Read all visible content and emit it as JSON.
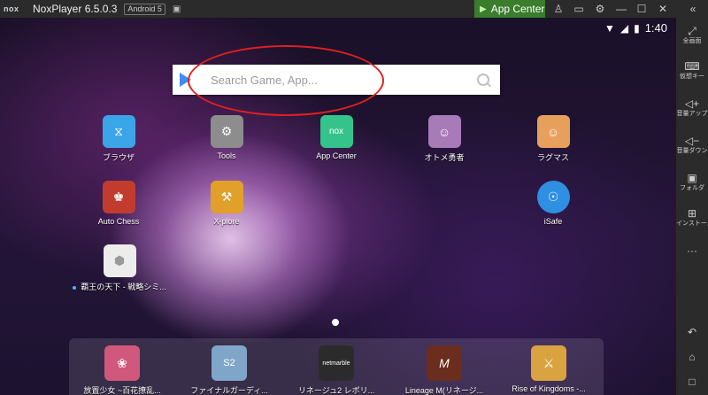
{
  "titlebar": {
    "logo": "nox",
    "app_name": "NoxPlayer 6.5.0.3",
    "android_badge": "Android 5",
    "app_center_label": "App Center",
    "buttons": [
      "shirt-icon",
      "minimize-window-icon",
      "settings-icon",
      "minimize-icon",
      "maximize-icon",
      "close-icon",
      "collapse-sidebar-icon"
    ]
  },
  "status": {
    "time": "1:40"
  },
  "search": {
    "placeholder": "Search Game, App..."
  },
  "apps": [
    {
      "label": "ブラウザ",
      "color": "#3aa6e8",
      "glyph": "⧖"
    },
    {
      "label": "Tools",
      "color": "#8d8d8d",
      "glyph": "⚙"
    },
    {
      "label": "App Center",
      "color": "#34c48b",
      "glyph": "nox"
    },
    {
      "label": "オトメ勇者",
      "color": "#a77ab8",
      "glyph": "☺"
    },
    {
      "label": "ラグマス",
      "color": "#e6a05c",
      "glyph": "☺"
    },
    {
      "label": "Auto Chess",
      "color": "#c23b2f",
      "glyph": "♚"
    },
    {
      "label": "X-plore",
      "color": "#e0a02a",
      "glyph": "⚒"
    },
    {
      "label": "iSafe",
      "color": "#2f8fe0",
      "glyph": "☉"
    },
    {
      "label": "覇王の天下 - 戦略シミ...",
      "color": "#ececec",
      "glyph": "⬢"
    }
  ],
  "dock": [
    {
      "label": "放置少女 ~百花撩乱...",
      "color": "#d0587c",
      "glyph": "❀"
    },
    {
      "label": "ファイナルガーディ...",
      "color": "#7fa6c9",
      "glyph": "S2"
    },
    {
      "label": "リネージュ2 レボリ...",
      "color": "#2b2b2b",
      "glyph": "netmarble"
    },
    {
      "label": "Lineage M(リネージ...",
      "color": "#6b2d1e",
      "glyph": "M"
    },
    {
      "label": "Rise of Kingdoms -...",
      "color": "#d8a340",
      "glyph": "⚔"
    }
  ],
  "sidebar": [
    {
      "icon": "fullscreen-icon",
      "glyph": "⤢",
      "label": "全画面"
    },
    {
      "icon": "virtual-key-icon",
      "glyph": "⌨",
      "label": "仮想キー"
    },
    {
      "icon": "volume-up-icon",
      "glyph": "🔊+",
      "label": "音量アップ"
    },
    {
      "icon": "volume-down-icon",
      "glyph": "🔈-",
      "label": "音量ダウン"
    },
    {
      "icon": "folder-icon",
      "glyph": "▣",
      "label": "フォルダ"
    },
    {
      "icon": "install-icon",
      "glyph": "⊞",
      "label": "インストール"
    },
    {
      "icon": "more-icon",
      "glyph": "···",
      "label": ""
    }
  ],
  "sidebar_bottom": [
    {
      "icon": "back-icon",
      "glyph": "↶"
    },
    {
      "icon": "home-icon",
      "glyph": "⌂"
    },
    {
      "icon": "recent-apps-icon",
      "glyph": "□"
    }
  ]
}
